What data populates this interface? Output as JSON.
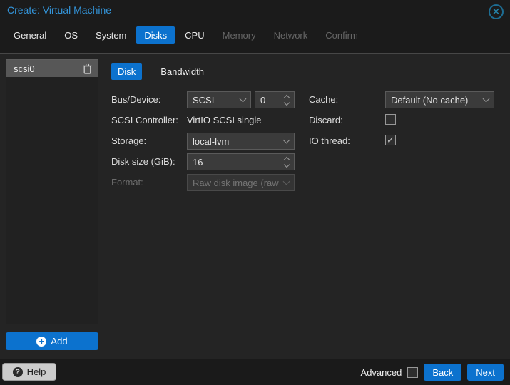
{
  "window": {
    "title": "Create: Virtual Machine",
    "close_icon": "circled-x"
  },
  "tabs": [
    {
      "label": "General"
    },
    {
      "label": "OS"
    },
    {
      "label": "System"
    },
    {
      "label": "Disks",
      "active": true
    },
    {
      "label": "CPU"
    },
    {
      "label": "Memory",
      "disabled": true
    },
    {
      "label": "Network",
      "disabled": true
    },
    {
      "label": "Confirm",
      "disabled": true
    }
  ],
  "sidebar": {
    "items": [
      {
        "label": "scsi0",
        "selected": true,
        "delete_icon": "trash-icon"
      }
    ],
    "add_button": {
      "label": "Add",
      "icon": "plus-circle-icon"
    }
  },
  "subtabs": [
    {
      "label": "Disk",
      "active": true
    },
    {
      "label": "Bandwidth"
    }
  ],
  "form": {
    "bus_device": {
      "label": "Bus/Device:",
      "bus_value": "SCSI",
      "device_number": "0"
    },
    "scsi_controller": {
      "label": "SCSI Controller:",
      "value": "VirtIO SCSI single"
    },
    "storage": {
      "label": "Storage:",
      "value": "local-lvm"
    },
    "disk_size": {
      "label": "Disk size (GiB):",
      "value": "16"
    },
    "format": {
      "label": "Format:",
      "value": "Raw disk image (raw",
      "disabled": true
    },
    "cache": {
      "label": "Cache:",
      "value": "Default (No cache)"
    },
    "discard": {
      "label": "Discard:",
      "checked": false
    },
    "io_thread": {
      "label": "IO thread:",
      "checked": true
    }
  },
  "footer": {
    "help_label": "Help",
    "help_icon": "question-circle-icon",
    "advanced_label": "Advanced",
    "advanced_checked": false,
    "back_label": "Back",
    "next_label": "Next"
  },
  "colors": {
    "accent_blue": "#0c72ce",
    "title_blue": "#3394d9",
    "content_bg": "#242424",
    "header_bg": "#1b1b1b",
    "field_bg": "#3b3b3b",
    "selected_row": "#575757"
  }
}
